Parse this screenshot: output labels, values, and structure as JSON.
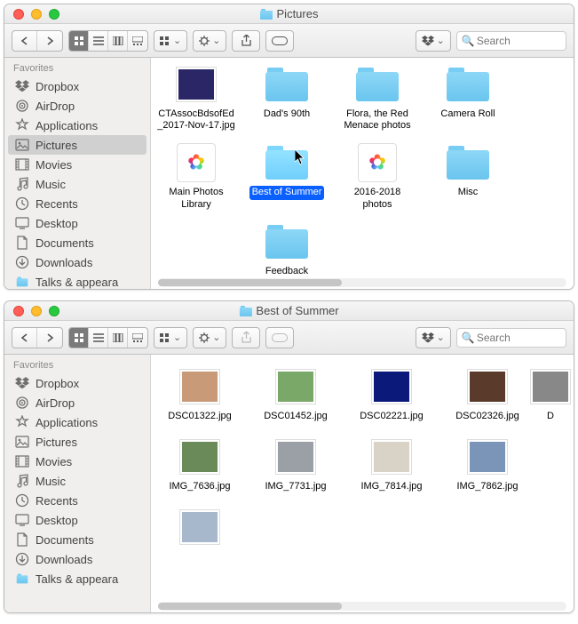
{
  "win1": {
    "title": "Pictures",
    "search_placeholder": "Search",
    "sidebar": {
      "header": "Favorites",
      "items": [
        {
          "label": "Dropbox"
        },
        {
          "label": "AirDrop"
        },
        {
          "label": "Applications"
        },
        {
          "label": "Pictures",
          "active": true
        },
        {
          "label": "Movies"
        },
        {
          "label": "Music"
        },
        {
          "label": "Recents"
        },
        {
          "label": "Desktop"
        },
        {
          "label": "Documents"
        },
        {
          "label": "Downloads"
        },
        {
          "label": "Talks & appeara"
        }
      ]
    },
    "items": [
      {
        "label": "CTAssocBdsofEd_2017-Nov-17.jpg",
        "type": "image",
        "fill": "#2b2766"
      },
      {
        "label": "Dad's 90th",
        "type": "folder"
      },
      {
        "label": "Flora, the Red Menace photos",
        "type": "folder"
      },
      {
        "label": "Camera Roll",
        "type": "folder"
      },
      {
        "label": "Main Photos Library",
        "type": "photoslib"
      },
      {
        "label": "Best of Summer",
        "type": "folder",
        "selected": true
      },
      {
        "label": "2016-2018 photos",
        "type": "photoslib"
      },
      {
        "label": "Misc",
        "type": "folder"
      },
      {
        "label": "",
        "type": "spacer"
      },
      {
        "label": "Feedback",
        "type": "folder"
      }
    ]
  },
  "win2": {
    "title": "Best of Summer",
    "search_placeholder": "Search",
    "sidebar": {
      "header": "Favorites",
      "items": [
        {
          "label": "Dropbox"
        },
        {
          "label": "AirDrop"
        },
        {
          "label": "Applications"
        },
        {
          "label": "Pictures"
        },
        {
          "label": "Movies"
        },
        {
          "label": "Music"
        },
        {
          "label": "Recents"
        },
        {
          "label": "Desktop"
        },
        {
          "label": "Documents"
        },
        {
          "label": "Downloads"
        },
        {
          "label": "Talks & appeara"
        }
      ]
    },
    "items": [
      {
        "label": "DSC01322.jpg",
        "type": "image",
        "fill": "#c99a78"
      },
      {
        "label": "DSC01452.jpg",
        "type": "image",
        "fill": "#7aa868"
      },
      {
        "label": "DSC02221.jpg",
        "type": "image",
        "fill": "#0b1a7a"
      },
      {
        "label": "DSC02326.jpg",
        "type": "image",
        "fill": "#5a3a2a"
      },
      {
        "label": "D",
        "type": "image",
        "fill": "#888",
        "clip": true
      },
      {
        "label": "IMG_7636.jpg",
        "type": "image",
        "fill": "#6a8a5a"
      },
      {
        "label": "IMG_7731.jpg",
        "type": "image",
        "fill": "#9aa0a5"
      },
      {
        "label": "IMG_7814.jpg",
        "type": "image",
        "fill": "#d9d2c6"
      },
      {
        "label": "IMG_7862.jpg",
        "type": "image",
        "fill": "#7a95b8"
      },
      {
        "label": "",
        "type": "image",
        "fill": "#a8b8cc",
        "partial": true
      }
    ]
  }
}
